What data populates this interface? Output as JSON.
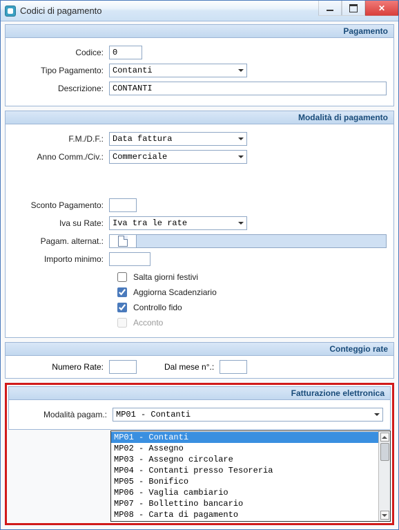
{
  "window": {
    "title": "Codici di pagamento"
  },
  "groups": {
    "pagamento": {
      "header": "Pagamento",
      "codice_label": "Codice:",
      "codice_value": "0",
      "tipo_label": "Tipo Pagamento:",
      "tipo_value": "Contanti",
      "descrizione_label": "Descrizione:",
      "descrizione_value": "CONTANTI"
    },
    "modalita": {
      "header": "Modalità di pagamento",
      "fmdf_label": "F.M./D.F.:",
      "fmdf_value": "Data fattura",
      "anno_label": "Anno Comm./Civ.:",
      "anno_value": "Commerciale",
      "sconto_label": "Sconto Pagamento:",
      "iva_label": "Iva su Rate:",
      "iva_value": "Iva tra le rate",
      "alternat_label": "Pagam. alternat.:",
      "importo_label": "Importo minimo:",
      "chk_festivi": "Salta giorni festivi",
      "chk_scad": "Aggiorna Scadenziario",
      "chk_fido": "Controllo fido",
      "chk_acconto": "Acconto"
    },
    "conteggio": {
      "header": "Conteggio rate",
      "numero_label": "Numero Rate:",
      "mese_label": "Dal mese n°.:"
    },
    "fatt": {
      "header": "Fatturazione elettronica",
      "mod_label": "Modalità pagam.:",
      "mod_value": "MP01 - Contanti",
      "options": [
        "MP01 - Contanti",
        "MP02 - Assegno",
        "MP03 - Assegno circolare",
        "MP04 - Contanti presso Tesoreria",
        "MP05 - Bonifico",
        "MP06 - Vaglia cambiario",
        "MP07 - Bollettino bancario",
        "MP08 - Carta di pagamento"
      ]
    }
  }
}
